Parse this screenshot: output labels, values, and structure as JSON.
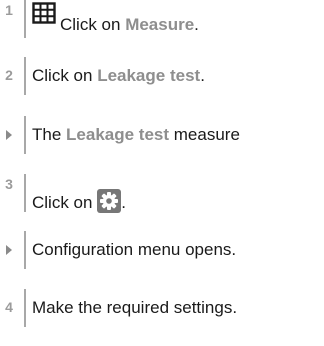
{
  "steps": [
    {
      "marker": "1",
      "prefix": "Click on ",
      "highlight": "Measure",
      "suffix": ".",
      "icon": "grid-table-icon"
    },
    {
      "marker": "2",
      "prefix": "Click on ",
      "highlight": "Leakage test",
      "suffix": "."
    },
    {
      "marker": "result-arrow",
      "prefix": "The ",
      "highlight": "Leakage test",
      "suffix": " measure"
    },
    {
      "marker": "3",
      "prefix": "Click on ",
      "suffix": ".",
      "icon": "gear-icon"
    },
    {
      "marker": "result-arrow",
      "text": "Configuration menu opens."
    },
    {
      "marker": "4",
      "text": "Make the required settings."
    }
  ],
  "colors": {
    "highlight": "#8e8e8e",
    "marker": "#9b9b9b",
    "rule": "#a8a8a8",
    "icon": "#1a1a1a",
    "gear_bg": "#777777"
  }
}
